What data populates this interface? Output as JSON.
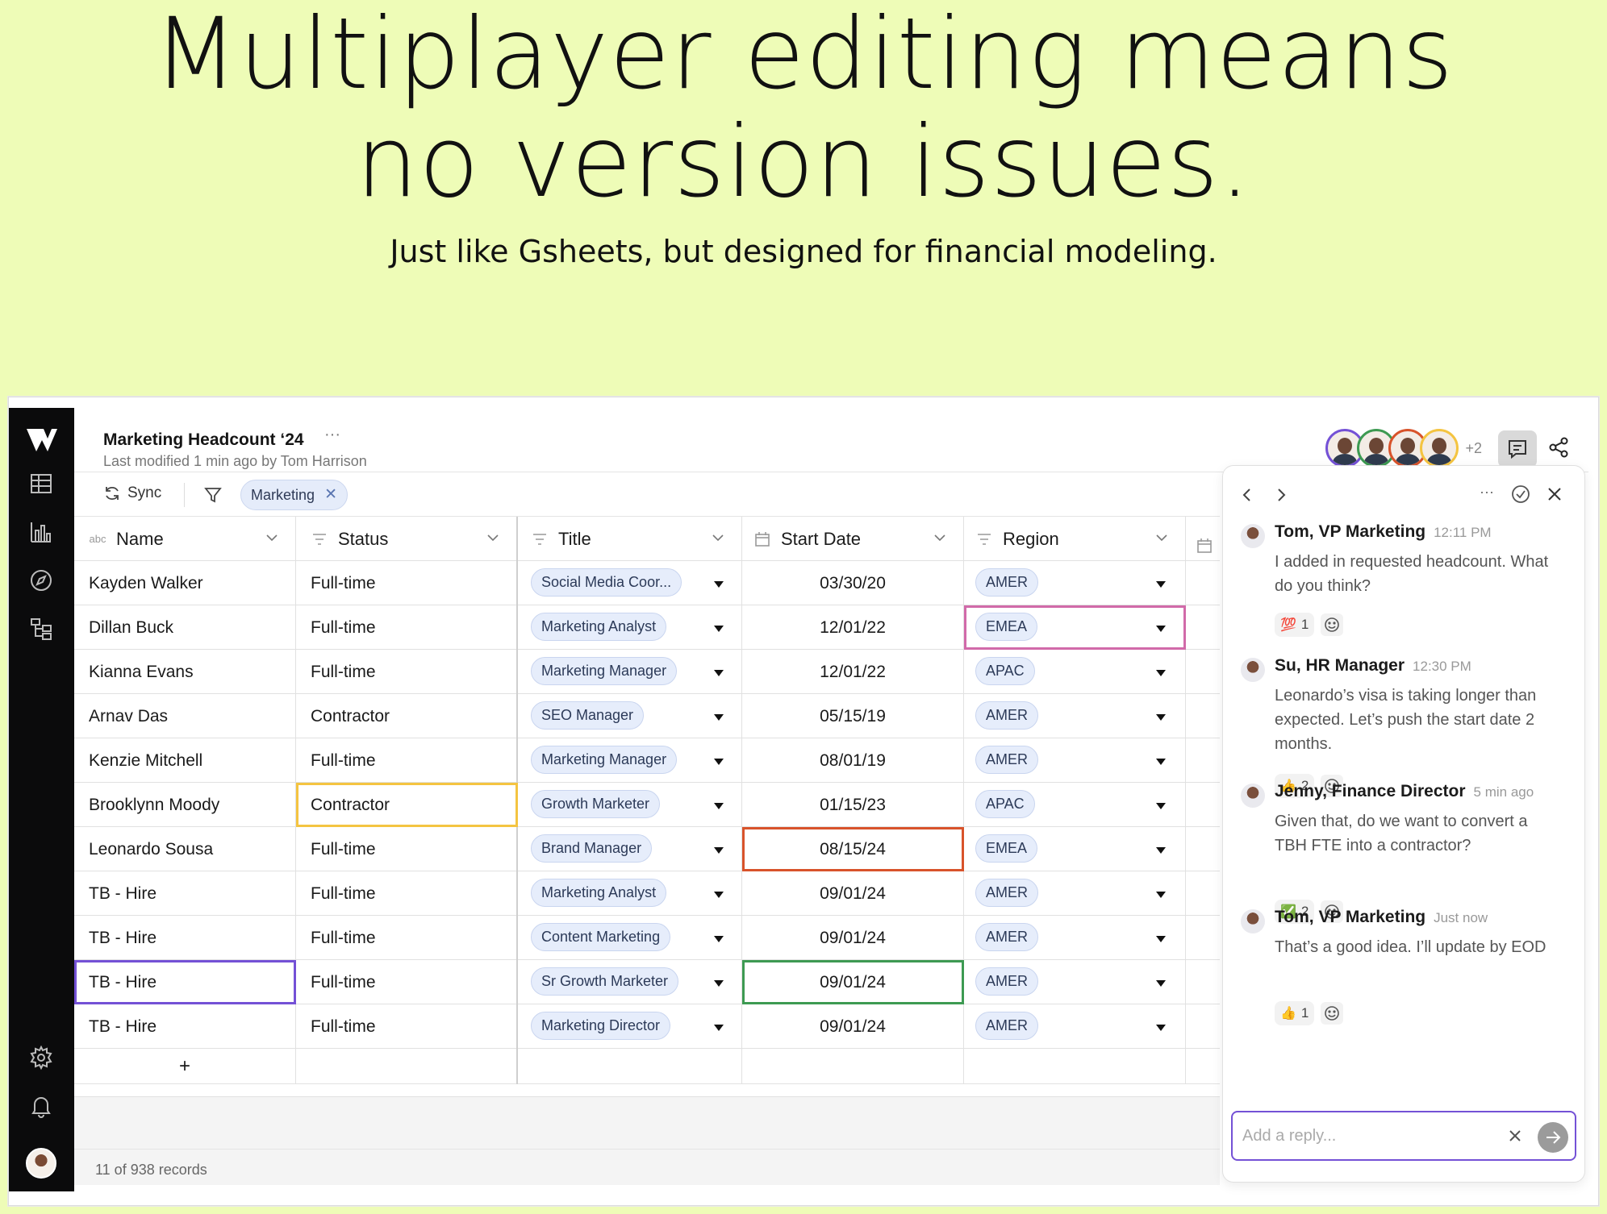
{
  "hero": {
    "title_line1": "Multiplayer editing means",
    "title_line2": "no version issues.",
    "subtitle": "Just like Gsheets, but designed for financial modeling."
  },
  "app": {
    "doc_title": "Marketing Headcount ‘24",
    "doc_more": "···",
    "last_modified": "Last modified 1 min ago by Tom Harrison",
    "collaborators_more": "+2",
    "collaborator_colors": [
      "#7451d6",
      "#3d9a52",
      "#d8532b",
      "#f4c441"
    ],
    "sidebar_icons": [
      "logo-icon",
      "table-icon",
      "chart-icon",
      "compass-icon",
      "hierarchy-icon",
      "settings-icon",
      "bell-icon",
      "avatar"
    ]
  },
  "toolbar": {
    "sync_label": "Sync",
    "filter_chip": "Marketing"
  },
  "table": {
    "name_type_badge": "abc",
    "headers": [
      "Name",
      "Status",
      "Title",
      "Start Date",
      "Region"
    ],
    "rows": [
      {
        "name": "Kayden Walker",
        "status": "Full-time",
        "title": "Social Media Coor...",
        "start": "03/30/20",
        "region": "AMER"
      },
      {
        "name": "Dillan Buck",
        "status": "Full-time",
        "title": "Marketing Analyst",
        "start": "12/01/22",
        "region": "EMEA"
      },
      {
        "name": "Kianna Evans",
        "status": "Full-time",
        "title": "Marketing Manager",
        "start": "12/01/22",
        "region": "APAC"
      },
      {
        "name": "Arnav Das",
        "status": "Contractor",
        "title": "SEO Manager",
        "start": "05/15/19",
        "region": "AMER"
      },
      {
        "name": "Kenzie Mitchell",
        "status": "Full-time",
        "title": "Marketing Manager",
        "start": "08/01/19",
        "region": "AMER"
      },
      {
        "name": "Brooklynn Moody",
        "status": "Contractor",
        "title": "Growth Marketer",
        "start": "01/15/23",
        "region": "APAC"
      },
      {
        "name": "Leonardo Sousa",
        "status": "Full-time",
        "title": "Brand Manager",
        "start": "08/15/24",
        "region": "EMEA"
      },
      {
        "name": "TB - Hire",
        "status": "Full-time",
        "title": "Marketing Analyst",
        "start": "09/01/24",
        "region": "AMER"
      },
      {
        "name": "TB - Hire",
        "status": "Full-time",
        "title": "Content Marketing",
        "start": "09/01/24",
        "region": "AMER"
      },
      {
        "name": "TB - Hire",
        "status": "Full-time",
        "title": "Sr Growth Marketer",
        "start": "09/01/24",
        "region": "AMER"
      },
      {
        "name": "TB - Hire",
        "status": "Full-time",
        "title": "Marketing Director",
        "start": "09/01/24",
        "region": "AMER"
      }
    ],
    "add_row_label": "+",
    "records_label": "11 of 938 records"
  },
  "comments": {
    "more": "···",
    "items": [
      {
        "author": "Tom, VP Marketing",
        "time": "12:11 PM",
        "text": "I added in requested headcount. What do you think?",
        "emoji": "💯",
        "count": "1"
      },
      {
        "author": "Su, HR Manager",
        "time": "12:30 PM",
        "text": "Leonardo’s visa is taking longer than expected. Let’s push the start date 2 months.",
        "emoji": "👍",
        "count": "2"
      },
      {
        "author": "Jenny, Finance Director",
        "time": "5 min ago",
        "text": "Given that, do we want to convert a TBH FTE into a contractor?",
        "emoji": "✅",
        "count": "2"
      },
      {
        "author": "Tom, VP Marketing",
        "time": "Just now",
        "text": "That’s a good idea. I’ll update by EOD",
        "emoji": "👍",
        "count": "1"
      }
    ],
    "reply_placeholder": "Add a reply..."
  }
}
